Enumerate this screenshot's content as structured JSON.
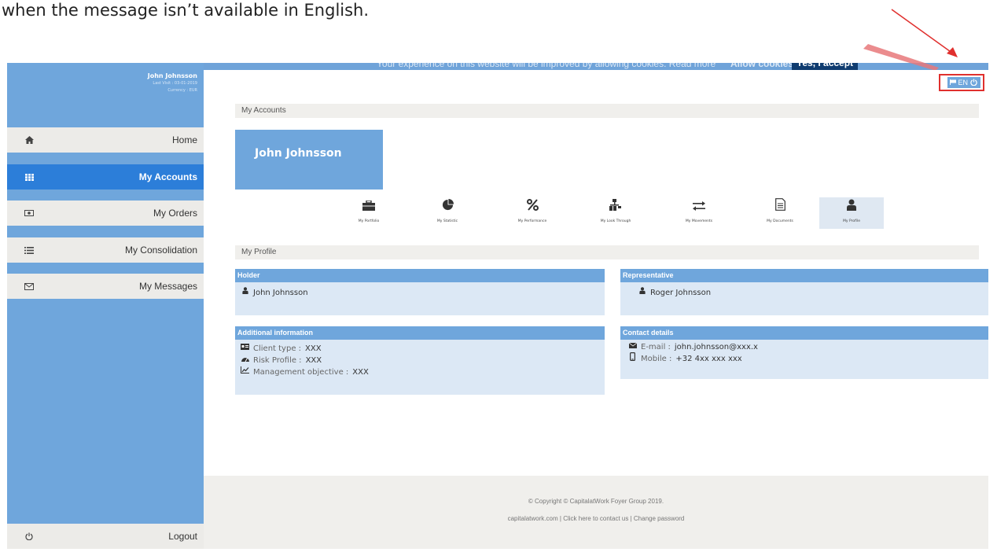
{
  "doc_text": "when the message isn’t available in English.",
  "cookie": {
    "text": "Your experience on this website will be improved by allowing cookies. Read more",
    "allow": "Allow cookies!",
    "accept": "Yes, I accept"
  },
  "user": {
    "name": "John Johnsson",
    "last_visit": "Last Visit : 03-01-2019",
    "currency": "Currency : EUR"
  },
  "nav": [
    {
      "label": "Home",
      "icon": "home-icon"
    },
    {
      "label": "My Accounts",
      "icon": "grid-icon"
    },
    {
      "label": "My Orders",
      "icon": "money-icon"
    },
    {
      "label": "My Consolidation",
      "icon": "list-icon"
    },
    {
      "label": "My Messages",
      "icon": "envelope-icon"
    }
  ],
  "logout": "Logout",
  "lang": "EN",
  "section_accounts": "My Accounts",
  "account_name": "John Johnsson",
  "tabs": [
    {
      "label": "My Portfolio",
      "icon": "briefcase-icon"
    },
    {
      "label": "My Statistic",
      "icon": "pie-chart-icon"
    },
    {
      "label": "My Performance",
      "icon": "percent-icon"
    },
    {
      "label": "My Look Through",
      "icon": "sitemap-icon"
    },
    {
      "label": "My Movements",
      "icon": "exchange-icon"
    },
    {
      "label": "My Documents",
      "icon": "document-icon"
    },
    {
      "label": "My Profile",
      "icon": "user-icon"
    }
  ],
  "section_profile": "My Profile",
  "holder": {
    "title": "Holder",
    "name": "John Johnsson"
  },
  "representative": {
    "title": "Representative",
    "name": "Roger Johnsson"
  },
  "additional": {
    "title": "Additional information",
    "client_type_label": "Client type :",
    "client_type_value": "XXX",
    "risk_label": "Risk Profile :",
    "risk_value": "XXX",
    "objective_label": "Management objective :",
    "objective_value": "XXX"
  },
  "contact": {
    "title": "Contact details",
    "email_label": "E-mail :",
    "email_value": "john.johnsson@xxx.x",
    "mobile_label": "Mobile :",
    "mobile_value": "+32 4xx xxx xxx"
  },
  "footer": {
    "copyright": "© Copyright © CapitalatWork Foyer Group 2019.",
    "link_site": "capitalatwork.com",
    "link_contact": "Click here to contact us",
    "link_password": "Change password"
  },
  "colors": {
    "sidebar": "#6fa6dc",
    "active": "#2c7ed9",
    "annotation": "#e0302e"
  }
}
